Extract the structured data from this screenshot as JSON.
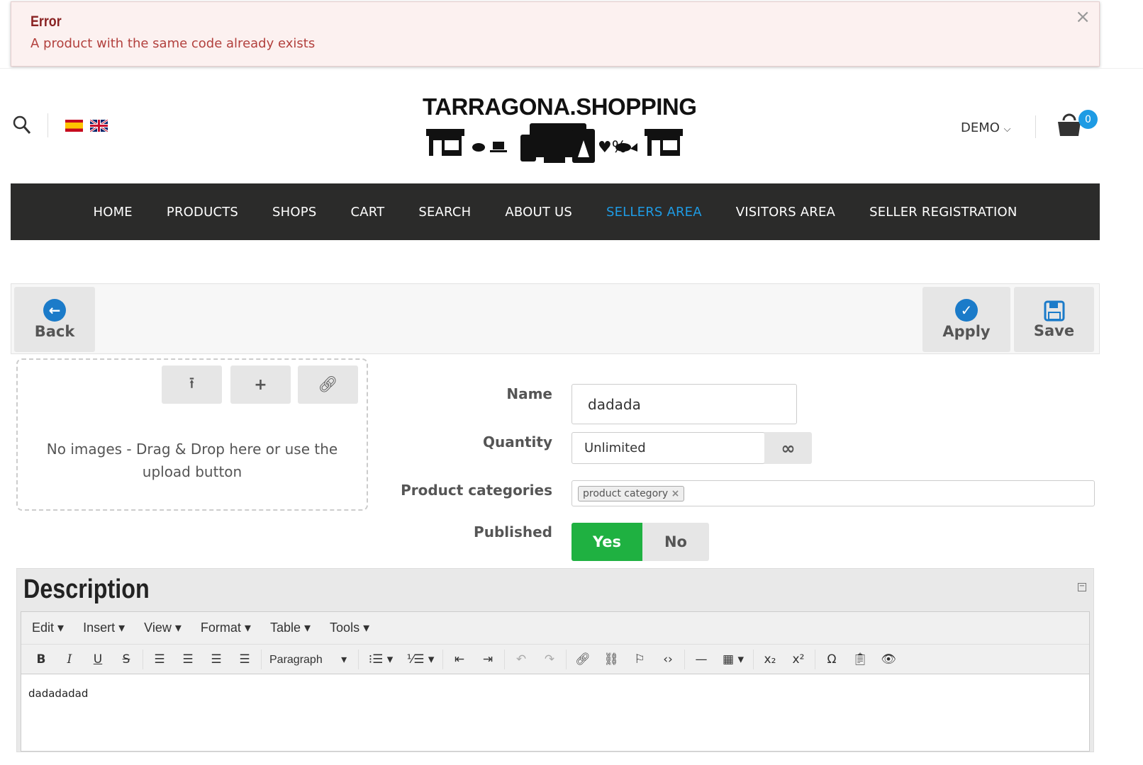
{
  "alert": {
    "title": "Error",
    "message": "A product with the same code already exists",
    "close": "×"
  },
  "header": {
    "logo_text": "TARRAGONA.SHOPPING",
    "user": "DEMO",
    "cart_count": "0"
  },
  "nav": {
    "items": [
      "HOME",
      "PRODUCTS",
      "SHOPS",
      "CART",
      "SEARCH",
      "ABOUT US",
      "SELLERS AREA",
      "VISITORS AREA",
      "SELLER REGISTRATION"
    ],
    "active": "SELLERS AREA"
  },
  "toolbar": {
    "back": "Back",
    "apply": "Apply",
    "save": "Save"
  },
  "images": {
    "empty_message": "No images - Drag & Drop here or use the upload button"
  },
  "form": {
    "name_label": "Name",
    "name_value": "dadada",
    "quantity_label": "Quantity",
    "quantity_value": "Unlimited",
    "categories_label": "Product categories",
    "category_tag": "product category",
    "published_label": "Published",
    "yes": "Yes",
    "no": "No"
  },
  "description": {
    "title": "Description",
    "menu": [
      "Edit",
      "Insert",
      "View",
      "Format",
      "Table",
      "Tools"
    ],
    "format_select": "Paragraph",
    "content": "dadadadad"
  },
  "colors": {
    "accent": "#1e9be4",
    "success": "#1fb141",
    "nav_bg": "#2b2b2a"
  }
}
